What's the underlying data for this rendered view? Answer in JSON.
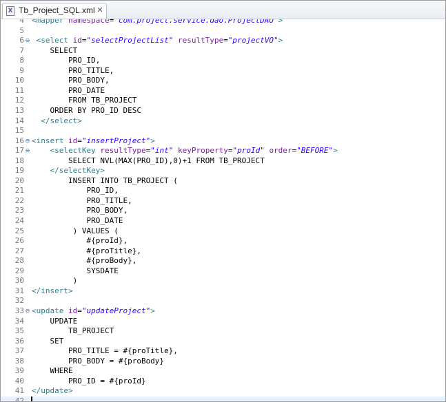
{
  "tab": {
    "title": "Tb_Project_SQL.xml",
    "icon": "xml-file-icon",
    "close_glyph": "✕"
  },
  "editor": {
    "lines": [
      {
        "num": "4",
        "fold": "",
        "parts": [
          {
            "c": "t",
            "s": "<mapper "
          },
          {
            "c": "a",
            "s": "namespace"
          },
          {
            "c": "txt",
            "s": "="
          },
          {
            "c": "v",
            "s": "\"com.project.service.dao.ProjectDAO\""
          },
          {
            "c": "t",
            "s": ">"
          }
        ]
      },
      {
        "num": "5",
        "fold": "",
        "parts": []
      },
      {
        "num": "6",
        "fold": "⊖",
        "parts": [
          {
            "c": "txt",
            "s": " "
          },
          {
            "c": "t",
            "s": "<select "
          },
          {
            "c": "a",
            "s": "id"
          },
          {
            "c": "txt",
            "s": "="
          },
          {
            "c": "v",
            "s": "\"selectProjectList\""
          },
          {
            "c": "txt",
            "s": " "
          },
          {
            "c": "a",
            "s": "resultType"
          },
          {
            "c": "txt",
            "s": "="
          },
          {
            "c": "v",
            "s": "\"projectVO\""
          },
          {
            "c": "t",
            "s": ">"
          }
        ]
      },
      {
        "num": "7",
        "fold": "",
        "parts": [
          {
            "c": "txt",
            "s": "    SELECT"
          }
        ]
      },
      {
        "num": "8",
        "fold": "",
        "parts": [
          {
            "c": "txt",
            "s": "        PRO_ID,"
          }
        ]
      },
      {
        "num": "9",
        "fold": "",
        "parts": [
          {
            "c": "txt",
            "s": "        PRO_TITLE,"
          }
        ]
      },
      {
        "num": "10",
        "fold": "",
        "parts": [
          {
            "c": "txt",
            "s": "        PRO_BODY,"
          }
        ]
      },
      {
        "num": "11",
        "fold": "",
        "parts": [
          {
            "c": "txt",
            "s": "        PRO_DATE"
          }
        ]
      },
      {
        "num": "12",
        "fold": "",
        "parts": [
          {
            "c": "txt",
            "s": "        FROM TB_PROJECT"
          }
        ]
      },
      {
        "num": "13",
        "fold": "",
        "parts": [
          {
            "c": "txt",
            "s": "    ORDER BY PRO_ID DESC"
          }
        ]
      },
      {
        "num": "14",
        "fold": "",
        "parts": [
          {
            "c": "txt",
            "s": "  "
          },
          {
            "c": "t",
            "s": "</select>"
          }
        ]
      },
      {
        "num": "15",
        "fold": "",
        "parts": []
      },
      {
        "num": "16",
        "fold": "⊖",
        "parts": [
          {
            "c": "t",
            "s": "<insert "
          },
          {
            "c": "a",
            "s": "id"
          },
          {
            "c": "txt",
            "s": "="
          },
          {
            "c": "v",
            "s": "\"insertProject\""
          },
          {
            "c": "t",
            "s": ">"
          }
        ]
      },
      {
        "num": "17",
        "fold": "⊖",
        "parts": [
          {
            "c": "txt",
            "s": "    "
          },
          {
            "c": "t",
            "s": "<selectKey "
          },
          {
            "c": "a",
            "s": "resultType"
          },
          {
            "c": "txt",
            "s": "="
          },
          {
            "c": "v",
            "s": "\"int\""
          },
          {
            "c": "txt",
            "s": " "
          },
          {
            "c": "a",
            "s": "keyProperty"
          },
          {
            "c": "txt",
            "s": "="
          },
          {
            "c": "v",
            "s": "\"proId\""
          },
          {
            "c": "txt",
            "s": " "
          },
          {
            "c": "a",
            "s": "order"
          },
          {
            "c": "txt",
            "s": "="
          },
          {
            "c": "v",
            "s": "\"BEFORE\""
          },
          {
            "c": "t",
            "s": ">"
          }
        ]
      },
      {
        "num": "18",
        "fold": "",
        "parts": [
          {
            "c": "txt",
            "s": "        SELECT NVL(MAX(PRO_ID),0)+1 FROM TB_PROJECT"
          }
        ]
      },
      {
        "num": "19",
        "fold": "",
        "parts": [
          {
            "c": "txt",
            "s": "    "
          },
          {
            "c": "t",
            "s": "</selectKey>"
          }
        ]
      },
      {
        "num": "20",
        "fold": "",
        "parts": [
          {
            "c": "txt",
            "s": "        INSERT INTO TB_PROJECT ("
          }
        ]
      },
      {
        "num": "21",
        "fold": "",
        "parts": [
          {
            "c": "txt",
            "s": "            PRO_ID,"
          }
        ]
      },
      {
        "num": "22",
        "fold": "",
        "parts": [
          {
            "c": "txt",
            "s": "            PRO_TITLE,"
          }
        ]
      },
      {
        "num": "23",
        "fold": "",
        "parts": [
          {
            "c": "txt",
            "s": "            PRO_BODY,"
          }
        ]
      },
      {
        "num": "24",
        "fold": "",
        "parts": [
          {
            "c": "txt",
            "s": "            PRO_DATE"
          }
        ]
      },
      {
        "num": "25",
        "fold": "",
        "parts": [
          {
            "c": "txt",
            "s": "         ) VALUES ("
          }
        ]
      },
      {
        "num": "26",
        "fold": "",
        "parts": [
          {
            "c": "txt",
            "s": "            #{proId},"
          }
        ]
      },
      {
        "num": "27",
        "fold": "",
        "parts": [
          {
            "c": "txt",
            "s": "            #{proTitle},"
          }
        ]
      },
      {
        "num": "28",
        "fold": "",
        "parts": [
          {
            "c": "txt",
            "s": "            #{proBody},"
          }
        ]
      },
      {
        "num": "29",
        "fold": "",
        "parts": [
          {
            "c": "txt",
            "s": "            SYSDATE"
          }
        ]
      },
      {
        "num": "30",
        "fold": "",
        "parts": [
          {
            "c": "txt",
            "s": "         )"
          }
        ]
      },
      {
        "num": "31",
        "fold": "",
        "parts": [
          {
            "c": "t",
            "s": "</insert>"
          }
        ]
      },
      {
        "num": "32",
        "fold": "",
        "parts": []
      },
      {
        "num": "33",
        "fold": "⊖",
        "parts": [
          {
            "c": "t",
            "s": "<update "
          },
          {
            "c": "a",
            "s": "id"
          },
          {
            "c": "txt",
            "s": "="
          },
          {
            "c": "v",
            "s": "\"updateProject\""
          },
          {
            "c": "t",
            "s": ">"
          }
        ]
      },
      {
        "num": "34",
        "fold": "",
        "parts": [
          {
            "c": "txt",
            "s": "    UPDATE"
          }
        ]
      },
      {
        "num": "35",
        "fold": "",
        "parts": [
          {
            "c": "txt",
            "s": "        TB_PROJECT"
          }
        ]
      },
      {
        "num": "36",
        "fold": "",
        "parts": [
          {
            "c": "txt",
            "s": "    SET"
          }
        ]
      },
      {
        "num": "37",
        "fold": "",
        "parts": [
          {
            "c": "txt",
            "s": "        PRO_TITLE = #{proTitle},"
          }
        ]
      },
      {
        "num": "38",
        "fold": "",
        "parts": [
          {
            "c": "txt",
            "s": "        PRO_BODY = #{proBody}"
          }
        ]
      },
      {
        "num": "39",
        "fold": "",
        "parts": [
          {
            "c": "txt",
            "s": "    WHERE"
          }
        ]
      },
      {
        "num": "40",
        "fold": "",
        "parts": [
          {
            "c": "txt",
            "s": "        PRO_ID = #{proId}"
          }
        ]
      },
      {
        "num": "41",
        "fold": "",
        "parts": [
          {
            "c": "t",
            "s": "</update>"
          }
        ]
      },
      {
        "num": "42",
        "fold": "",
        "parts": []
      }
    ],
    "current_line": "42"
  },
  "colors": {
    "tag": "#2f7d8c",
    "attribute": "#7a1e9c",
    "value": "#2a00ff",
    "current_line_bg": "#e8f2fe"
  }
}
